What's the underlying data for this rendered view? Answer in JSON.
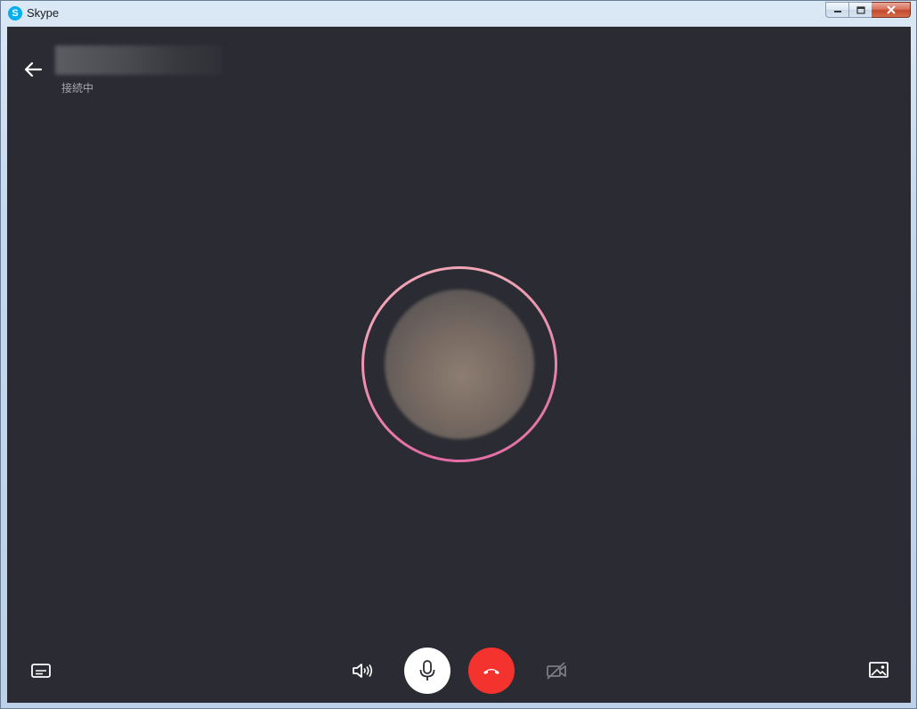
{
  "window": {
    "title": "Skype",
    "app_icon_letter": "S",
    "controls": {
      "minimize": "minimize-icon",
      "maximize": "restore-icon",
      "close": "close-icon"
    }
  },
  "call": {
    "status": "接続中",
    "contact_name": ""
  },
  "icons": {
    "back": "back-arrow-icon",
    "chat": "chat-icon",
    "speaker": "speaker-icon",
    "mic": "microphone-icon",
    "hangup": "hangup-icon",
    "video": "video-off-icon",
    "gallery": "gallery-icon"
  },
  "colors": {
    "background": "#2b2c33",
    "hangup": "#f4322e",
    "mic_button": "#ffffff",
    "ring_accent": "#e46aa5",
    "status_text": "#a6a7ad"
  }
}
